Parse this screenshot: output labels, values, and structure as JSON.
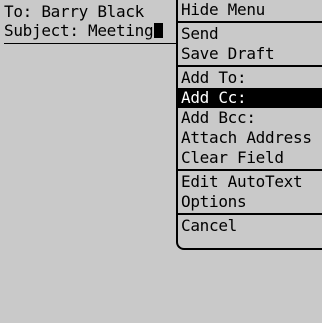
{
  "compose": {
    "to_label": "To:",
    "to_value": "Barry Black",
    "subject_label": "Subject:",
    "subject_value": "Meeting"
  },
  "menu": {
    "groups": [
      [
        "Hide Menu"
      ],
      [
        "Send",
        "Save Draft"
      ],
      [
        "Add To:",
        "Add Cc:",
        "Add Bcc:",
        "Attach Address",
        "Clear Field"
      ],
      [
        "Edit AutoText",
        "Options"
      ],
      [
        "Cancel"
      ]
    ],
    "selected": "Add Cc:"
  },
  "colors": {
    "background": "#c9c9c9",
    "selection_bg": "#000000",
    "selection_fg": "#ffffff"
  }
}
